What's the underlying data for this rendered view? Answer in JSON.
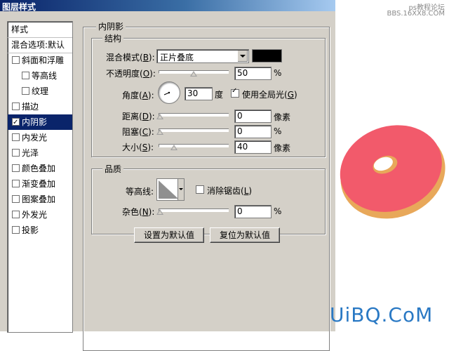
{
  "window": {
    "title": "图层样式"
  },
  "watermark": {
    "line1": "ps教程论坛",
    "line2": "BBS.16XX8.COM"
  },
  "brand": "UiBQ.CoM",
  "sidebar": {
    "header": "样式",
    "blend_options": "混合选项:默认",
    "items": [
      {
        "label": "斜面和浮雕",
        "checked": false,
        "indent": false
      },
      {
        "label": "等高线",
        "checked": false,
        "indent": true
      },
      {
        "label": "纹理",
        "checked": false,
        "indent": true
      },
      {
        "label": "描边",
        "checked": false,
        "indent": false
      },
      {
        "label": "内阴影",
        "checked": true,
        "indent": false,
        "selected": true
      },
      {
        "label": "内发光",
        "checked": false,
        "indent": false
      },
      {
        "label": "光泽",
        "checked": false,
        "indent": false
      },
      {
        "label": "颜色叠加",
        "checked": false,
        "indent": false
      },
      {
        "label": "渐变叠加",
        "checked": false,
        "indent": false
      },
      {
        "label": "图案叠加",
        "checked": false,
        "indent": false
      },
      {
        "label": "外发光",
        "checked": false,
        "indent": false
      },
      {
        "label": "投影",
        "checked": false,
        "indent": false
      }
    ]
  },
  "panel": {
    "title": "内阴影",
    "structure": {
      "title": "结构",
      "blend_mode_label": "混合模式(",
      "blend_mode_key": "B",
      "blend_mode_value": "正片叠底",
      "shadow_color": "#000000",
      "opacity_label": "不透明度(",
      "opacity_key": "O",
      "opacity_value": "50",
      "opacity_unit": "%",
      "opacity_level": 0.5,
      "angle_label": "角度(",
      "angle_key": "A",
      "angle_value": "30",
      "angle_unit": "度",
      "global_light_label": "使用全局光(",
      "global_light_key": "G",
      "global_light_checked": true,
      "distance_label": "距离(",
      "distance_key": "D",
      "distance_value": "0",
      "distance_unit": "像素",
      "choke_label": "阻塞(",
      "choke_key": "C",
      "choke_value": "0",
      "choke_unit": "%",
      "size_label": "大小(",
      "size_key": "S",
      "size_value": "40",
      "size_unit": "像素"
    },
    "quality": {
      "title": "品质",
      "contour_label": "等高线:",
      "antialias_label": "消除锯齿(",
      "antialias_key": "L",
      "antialias_checked": false,
      "noise_label": "杂色(",
      "noise_key": "N",
      "noise_value": "0",
      "noise_unit": "%"
    },
    "buttons": {
      "set_default": "设置为默认值",
      "reset_default": "复位为默认值"
    }
  },
  "preview": {
    "frosting_color": "#f25a6b",
    "dough_color": "#e8a85a"
  }
}
